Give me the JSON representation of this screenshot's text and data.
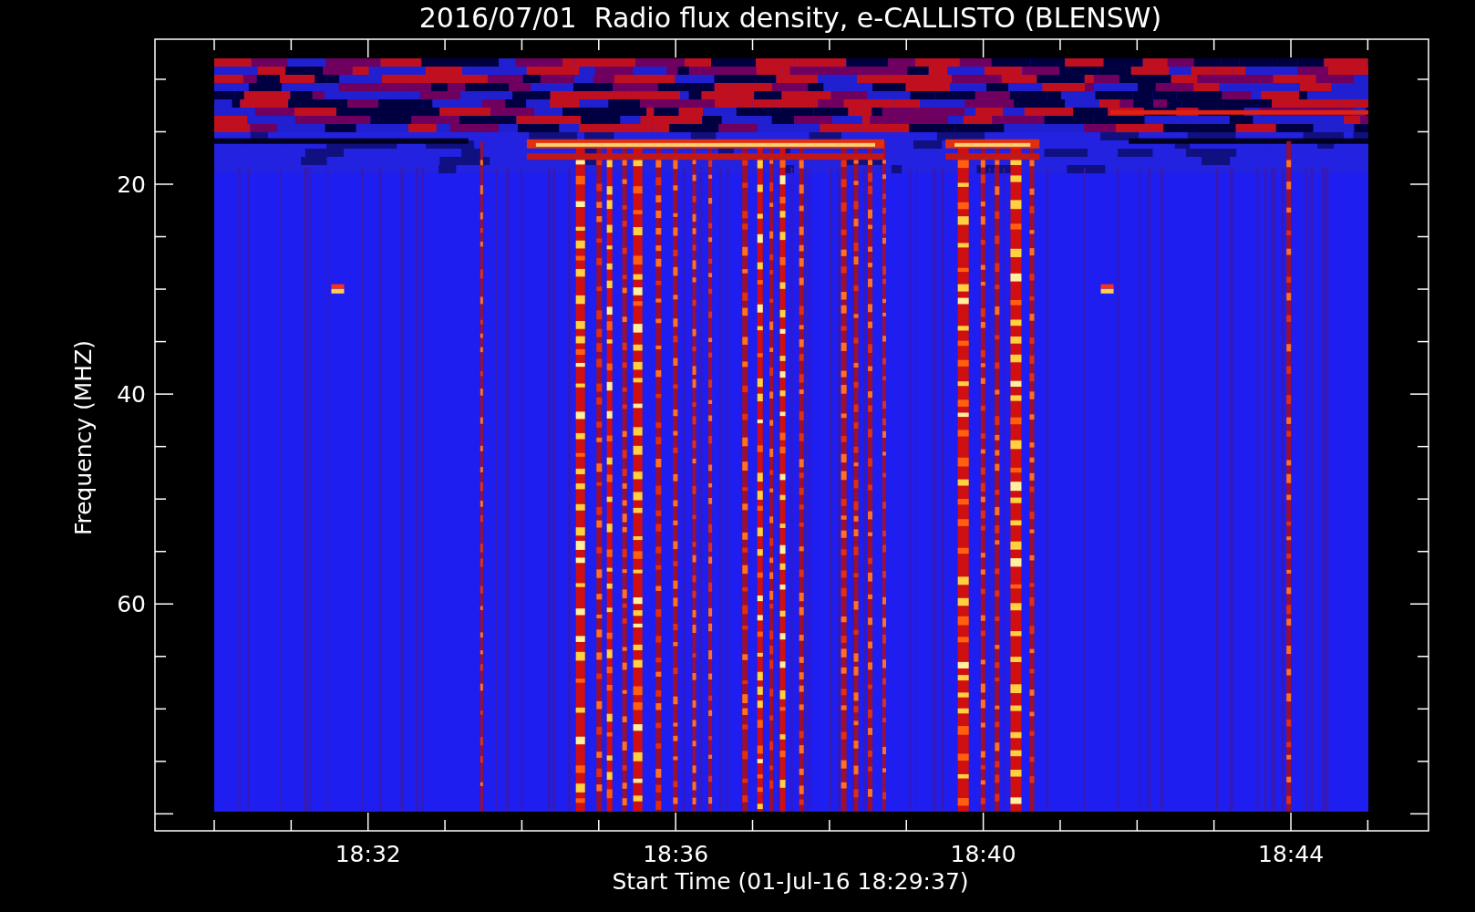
{
  "chart": {
    "title": "2016/07/01  Radio flux density, e-CALLISTO (BLENSW)",
    "ylabel": "Frequency (MHZ)",
    "xlabel": "Start Time (01-Jul-16 18:29:37)",
    "yticks": [
      "20",
      "40",
      "60"
    ],
    "xticks": [
      "18:32",
      "18:36",
      "18:40",
      "18:44"
    ]
  }
}
